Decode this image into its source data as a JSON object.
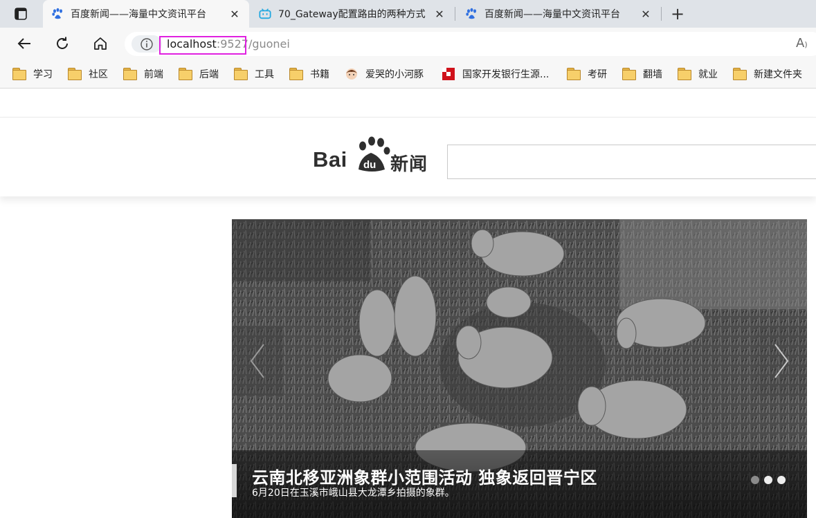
{
  "browser": {
    "tabs": [
      {
        "title": "百度新闻——海量中文资讯平台",
        "favicon": "baidu-paw-icon",
        "active": true
      },
      {
        "title": "70_Gateway配置路由的两种方式",
        "favicon": "bilibili-tv-icon",
        "active": false
      },
      {
        "title": "百度新闻——海量中文资讯平台",
        "favicon": "baidu-paw-icon",
        "active": false
      }
    ],
    "url_host": "localhost",
    "url_rest": ":9527/guonei",
    "read_aloud_label": "A",
    "bookmarks": [
      {
        "label": "学习",
        "icon": "folder-icon"
      },
      {
        "label": "社区",
        "icon": "folder-icon"
      },
      {
        "label": "前端",
        "icon": "folder-icon"
      },
      {
        "label": "后端",
        "icon": "folder-icon"
      },
      {
        "label": "工具",
        "icon": "folder-icon"
      },
      {
        "label": "书籍",
        "icon": "folder-icon"
      },
      {
        "label": "爱哭的小河豚",
        "icon": "avatar-icon"
      },
      {
        "label": "国家开发银行生源...",
        "icon": "cdb-logo-icon"
      },
      {
        "label": "考研",
        "icon": "folder-icon"
      },
      {
        "label": "翻墙",
        "icon": "folder-icon"
      },
      {
        "label": "就业",
        "icon": "folder-icon"
      },
      {
        "label": "新建文件夹",
        "icon": "folder-icon"
      }
    ]
  },
  "site": {
    "logo_bai": "Bai",
    "logo_du": "du",
    "logo_news": "新闻",
    "search_placeholder": "",
    "brand_color": "#2f2f2f"
  },
  "carousel": {
    "title": "云南北移亚洲象群小范围活动 独象返回晋宁区",
    "subtitle": "6月20日在玉溪市峨山县大龙潭乡拍摄的象群。",
    "slide_count": 3,
    "active_index": 0
  },
  "colors": {
    "highlight": "#e020e0",
    "tabstrip": "#dfe3e8",
    "toolbar": "#f7f7f7"
  }
}
